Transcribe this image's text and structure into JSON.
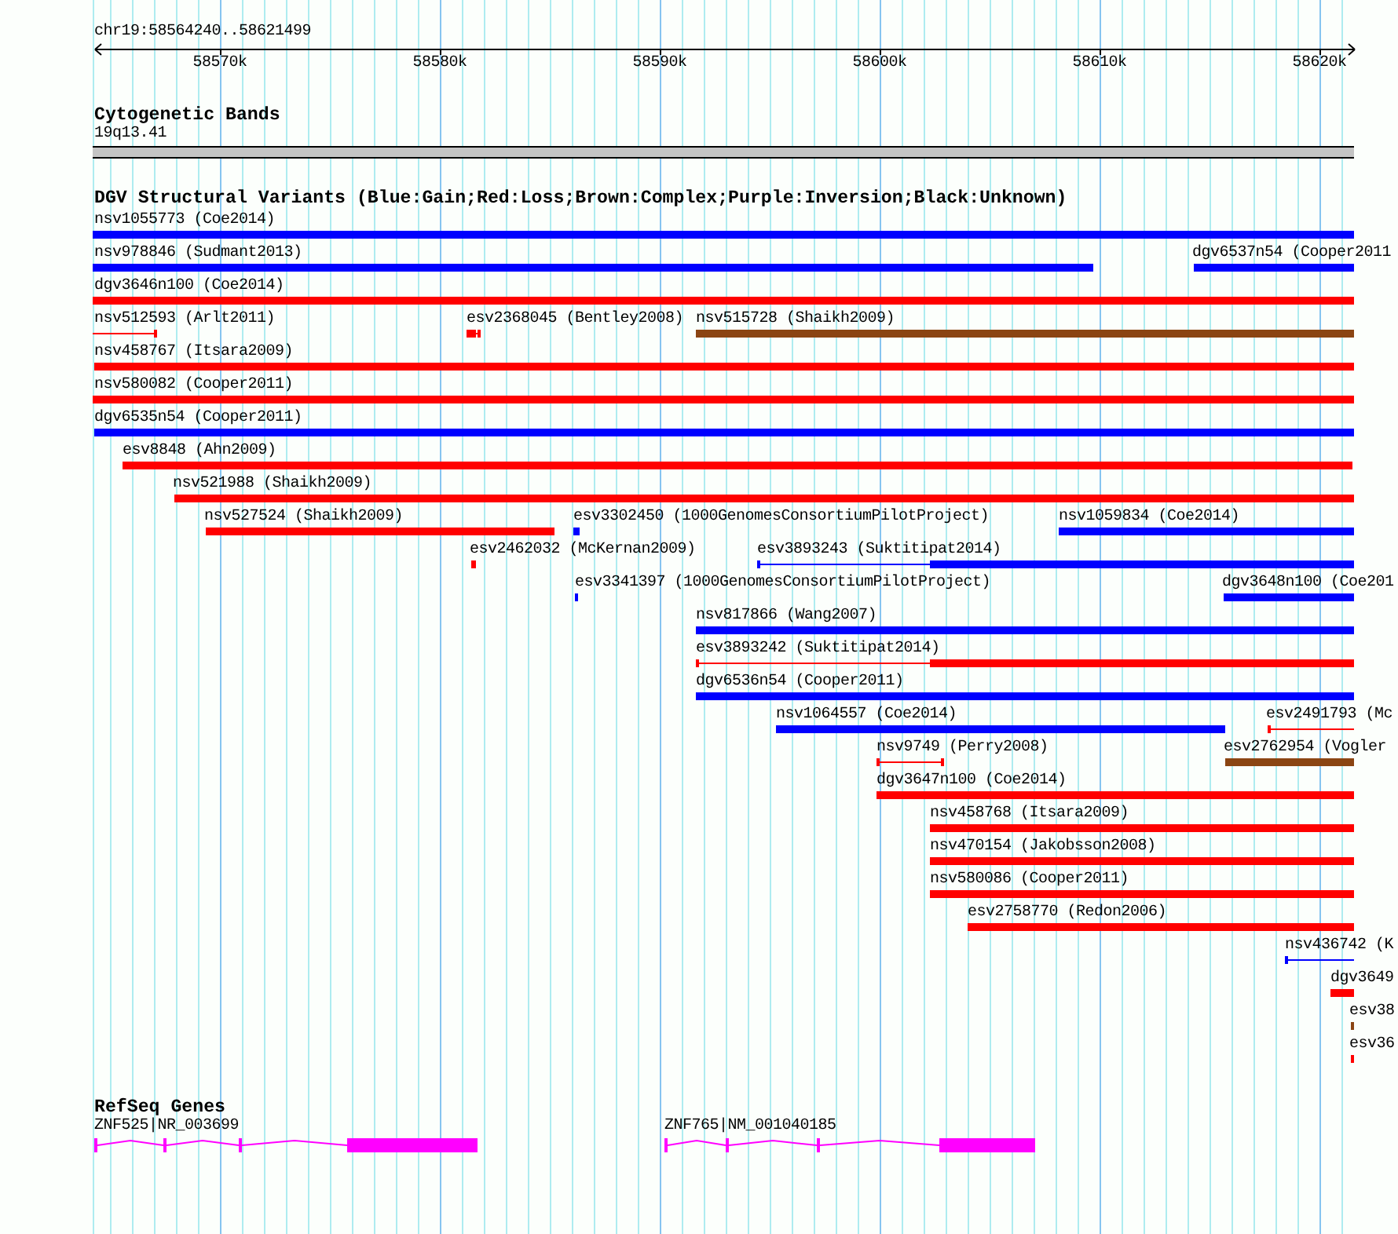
{
  "ruler": {
    "location": "chr19:58564240..58621499",
    "tick_labels": [
      "58570k",
      "58580k",
      "58590k",
      "58600k",
      "58610k",
      "58620k"
    ]
  },
  "cytogenetic_bands": {
    "title": "Cytogenetic Bands",
    "band": "19q13.41"
  },
  "dgv_structural_variants": {
    "title": "DGV Structural Variants (Blue:Gain;Red:Loss;Brown:Complex;Purple:Inversion;Black:Unknown)",
    "rows": [
      {
        "features": [
          {
            "label": "nsv1055773 (Coe2014)",
            "color": "#0000ff",
            "kind": "thick"
          }
        ]
      },
      {
        "features": [
          {
            "label": "nsv978846 (Sudmant2013)",
            "color": "#0000ff",
            "kind": "thick"
          },
          {
            "label": "dgv6537n54 (Cooper2011",
            "color": "#0000ff",
            "kind": "thick"
          }
        ]
      },
      {
        "features": [
          {
            "label": "dgv3646n100 (Coe2014)",
            "color": "#ff0000",
            "kind": "thick"
          }
        ]
      },
      {
        "features": [
          {
            "label": "nsv512593 (Arlt2011)",
            "color": "#ff0000",
            "kind": "thin"
          },
          {
            "label": "esv2368045 (Bentley2008)",
            "color": "#ff0000",
            "kind": "mixed"
          },
          {
            "label": "nsv515728 (Shaikh2009)",
            "color": "#8b4513",
            "kind": "thick"
          }
        ]
      },
      {
        "features": [
          {
            "label": "nsv458767 (Itsara2009)",
            "color": "#ff0000",
            "kind": "thick"
          }
        ]
      },
      {
        "features": [
          {
            "label": "nsv580082 (Cooper2011)",
            "color": "#ff0000",
            "kind": "thick"
          }
        ]
      },
      {
        "features": [
          {
            "label": "dgv6535n54 (Cooper2011)",
            "color": "#0000ff",
            "kind": "thick"
          }
        ]
      },
      {
        "features": [
          {
            "label": "esv8848 (Ahn2009)",
            "color": "#ff0000",
            "kind": "thick"
          }
        ]
      },
      {
        "features": [
          {
            "label": "nsv521988 (Shaikh2009)",
            "color": "#ff0000",
            "kind": "thick"
          }
        ]
      },
      {
        "features": [
          {
            "label": "nsv527524 (Shaikh2009)",
            "color": "#ff0000",
            "kind": "thick"
          },
          {
            "label": "esv3302450 (1000GenomesConsortiumPilotProject)",
            "color": "#0000ff",
            "kind": "thick"
          },
          {
            "label": "nsv1059834 (Coe2014)",
            "color": "#0000ff",
            "kind": "thick"
          }
        ]
      },
      {
        "features": [
          {
            "label": "esv2462032 (McKernan2009)",
            "color": "#ff0000",
            "kind": "thick"
          },
          {
            "label": "esv3893243 (Suktitipat2014)",
            "color": "#0000ff",
            "kind": "mixed"
          }
        ]
      },
      {
        "features": [
          {
            "label": "esv3341397 (1000GenomesConsortiumPilotProject)",
            "color": "#0000ff",
            "kind": "thick"
          },
          {
            "label": "dgv3648n100 (Coe201",
            "color": "#0000ff",
            "kind": "thick"
          }
        ]
      },
      {
        "features": [
          {
            "label": "nsv817866 (Wang2007)",
            "color": "#0000ff",
            "kind": "thick"
          }
        ]
      },
      {
        "features": [
          {
            "label": "esv3893242 (Suktitipat2014)",
            "color": "#ff0000",
            "kind": "mixed"
          }
        ]
      },
      {
        "features": [
          {
            "label": "dgv6536n54 (Cooper2011)",
            "color": "#0000ff",
            "kind": "thick"
          }
        ]
      },
      {
        "features": [
          {
            "label": "nsv1064557 (Coe2014)",
            "color": "#0000ff",
            "kind": "thick"
          },
          {
            "label": "esv2491793 (Mc",
            "color": "#ff0000",
            "kind": "thin"
          }
        ]
      },
      {
        "features": [
          {
            "label": "nsv9749 (Perry2008)",
            "color": "#ff0000",
            "kind": "thin"
          },
          {
            "label": "esv2762954 (Vogler",
            "color": "#8b4513",
            "kind": "thick"
          }
        ]
      },
      {
        "features": [
          {
            "label": "dgv3647n100 (Coe2014)",
            "color": "#ff0000",
            "kind": "thick"
          }
        ]
      },
      {
        "features": [
          {
            "label": "nsv458768 (Itsara2009)",
            "color": "#ff0000",
            "kind": "thick"
          }
        ]
      },
      {
        "features": [
          {
            "label": "nsv470154 (Jakobsson2008)",
            "color": "#ff0000",
            "kind": "thick"
          }
        ]
      },
      {
        "features": [
          {
            "label": "nsv580086 (Cooper2011)",
            "color": "#ff0000",
            "kind": "thick"
          }
        ]
      },
      {
        "features": [
          {
            "label": "esv2758770 (Redon2006)",
            "color": "#ff0000",
            "kind": "thick"
          }
        ]
      },
      {
        "features": [
          {
            "label": "nsv436742 (K",
            "color": "#0000ff",
            "kind": "thin"
          }
        ]
      },
      {
        "features": [
          {
            "label": "dgv3649",
            "color": "#ff0000",
            "kind": "thick"
          }
        ]
      },
      {
        "features": [
          {
            "label": "esv38",
            "color": "#8b4513",
            "kind": "thick"
          }
        ]
      },
      {
        "features": [
          {
            "label": "esv36",
            "color": "#ff0000",
            "kind": "thick"
          }
        ]
      }
    ]
  },
  "refseq_genes": {
    "title": "RefSeq Genes",
    "genes": [
      {
        "label": "ZNF525|NR_003699"
      },
      {
        "label": "ZNF765|NM_001040185"
      }
    ]
  }
}
